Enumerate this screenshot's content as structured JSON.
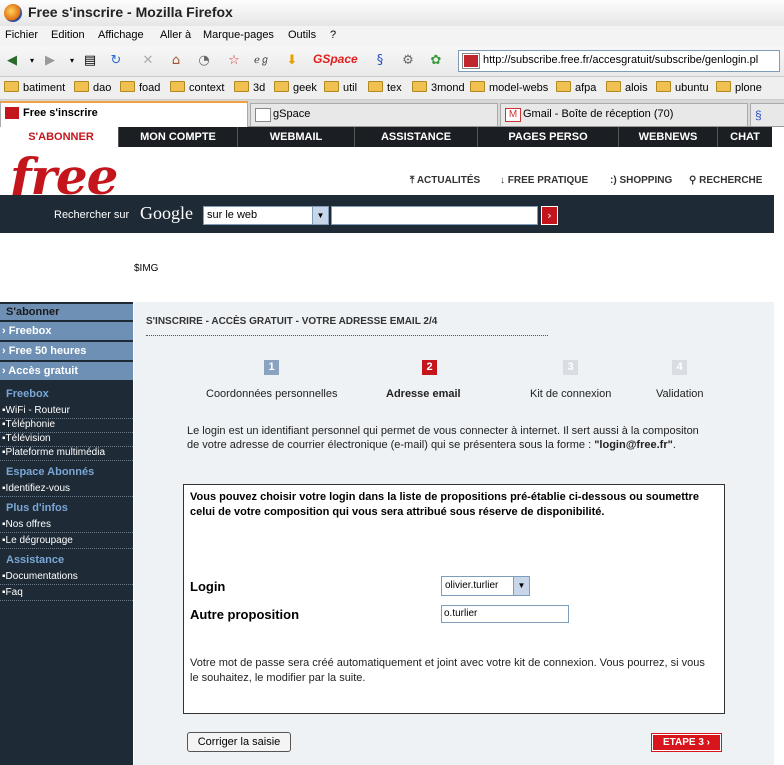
{
  "window": {
    "title": "Free s'inscrire - Mozilla Firefox"
  },
  "menu": [
    "Fichier",
    "Edition",
    "Affichage",
    "Aller à",
    "Marque-pages",
    "Outils",
    "?"
  ],
  "toolbar": {
    "gspace_label": "GSpace",
    "url": "http://subscribe.free.fr/accesgratuit/subscribe/genlogin.pl"
  },
  "bookmarks": [
    "batiment",
    "dao",
    "foad",
    "context",
    "3d",
    "geek",
    "util",
    "tex",
    "3mond",
    "model-webs",
    "afpa",
    "alois",
    "ubuntu",
    "plone"
  ],
  "tabs": [
    {
      "label": "Free s'inscrire"
    },
    {
      "label": "gSpace"
    },
    {
      "label": "Gmail - Boîte de réception (70)"
    }
  ],
  "site": {
    "nav": [
      "S'ABONNER",
      "MON COMPTE",
      "WEBMAIL",
      "ASSISTANCE",
      "PAGES PERSO",
      "WEBNEWS",
      "CHAT"
    ],
    "logo": "free",
    "header_links": [
      "ACTUALITÉS",
      "FREE PRATIQUE",
      ":) SHOPPING",
      "RECHERCHE"
    ],
    "search": {
      "label": "Rechercher sur",
      "google": "Google",
      "scope": "sur le web",
      "value": ""
    },
    "img_placeholder": "$IMG"
  },
  "sidebar": {
    "heading": "S'abonner",
    "primary": [
      "› Freebox",
      "› Free 50 heures",
      "› Accès gratuit"
    ],
    "sections": [
      {
        "title": "Freebox",
        "links": [
          "WiFi - Routeur",
          "Téléphonie",
          "Télévision",
          "Plateforme multimédia"
        ]
      },
      {
        "title": "Espace Abonnés",
        "links": [
          "Identifiez-vous"
        ]
      },
      {
        "title": "Plus d'infos",
        "links": [
          "Nos offres",
          "Le dégroupage"
        ]
      },
      {
        "title": "Assistance",
        "links": [
          "Documentations",
          "Faq"
        ]
      }
    ]
  },
  "main": {
    "title": "S'INSCRIRE - ACCÈS GRATUIT - VOTRE ADRESSE EMAIL 2/4",
    "steps": [
      {
        "num": "1",
        "label": "Coordonnées personnelles",
        "color": "#8aa3c0"
      },
      {
        "num": "2",
        "label": "Adresse email",
        "color": "#c4151c"
      },
      {
        "num": "3",
        "label": "Kit de connexion",
        "color": "#d8dde3"
      },
      {
        "num": "4",
        "label": "Validation",
        "color": "#d8dde3"
      }
    ],
    "intro_1": "Le login est un identifiant personnel qui permet de vous connecter à internet. Il sert aussi à la compositon de votre adresse de courrier électronique (e-mail) qui se présentera sous la forme :",
    "intro_login": "\"login@free.fr\"",
    "intro_end": ".",
    "box_text": "Vous pouvez choisir votre login dans la liste de propositions pré-établie ci-dessous ou soumettre celui de votre composition qui vous sera attribué sous réserve de disponibilité.",
    "login_label": "Login",
    "login_value": "olivier.turlier",
    "autre_label": "Autre proposition",
    "autre_value": "o.turlier",
    "pw_text": "Votre mot de passe sera créé automatiquement et joint avec votre kit de connexion. Vous pourrez, si vous le souhaitez, le modifier par la suite.",
    "reset_label": "Corriger la saisie",
    "next_label": "ETAPE 3 ›"
  }
}
